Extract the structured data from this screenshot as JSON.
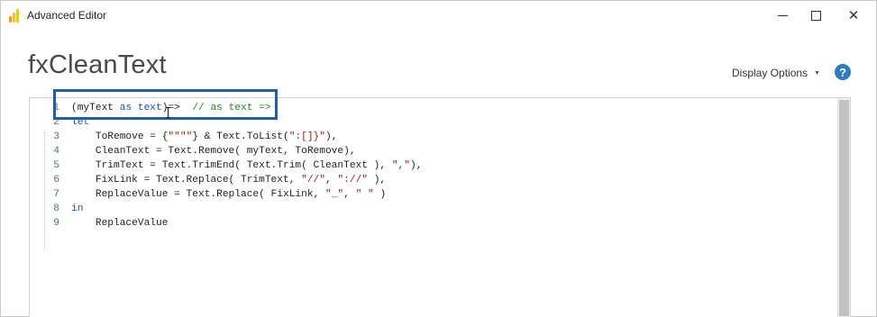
{
  "window": {
    "title": "Advanced Editor",
    "icon": "power-bi-icon",
    "minimize_icon": "minimize-icon",
    "maximize_icon": "maximize-icon",
    "close_label": "✕"
  },
  "header": {
    "query_name": "fxCleanText",
    "display_options_label": "Display Options",
    "display_options_caret": "▼",
    "help_label": "?"
  },
  "editor": {
    "lines": [
      {
        "number": "1",
        "tokens": [
          {
            "text": "(myText ",
            "kind": "plain"
          },
          {
            "text": "as",
            "kind": "keyword"
          },
          {
            "text": " ",
            "kind": "plain"
          },
          {
            "text": "text",
            "kind": "keyword"
          },
          {
            "text": ")=>  ",
            "kind": "plain"
          },
          {
            "text": "// as text =>",
            "kind": "comment"
          }
        ]
      },
      {
        "number": "2",
        "tokens": [
          {
            "text": "let",
            "kind": "keyword"
          }
        ]
      },
      {
        "number": "3",
        "tokens": [
          {
            "text": "    ToRemove = {",
            "kind": "plain"
          },
          {
            "text": "\"\"\"\"",
            "kind": "string"
          },
          {
            "text": "} & Text.ToList(",
            "kind": "plain"
          },
          {
            "text": "\":[]}\"",
            "kind": "string"
          },
          {
            "text": "),",
            "kind": "plain"
          }
        ]
      },
      {
        "number": "4",
        "tokens": [
          {
            "text": "    CleanText = Text.Remove( myText, ToRemove),",
            "kind": "plain"
          }
        ]
      },
      {
        "number": "5",
        "tokens": [
          {
            "text": "    TrimText = Text.TrimEnd( Text.Trim( CleanText ), ",
            "kind": "plain"
          },
          {
            "text": "\",\"",
            "kind": "string"
          },
          {
            "text": "),",
            "kind": "plain"
          }
        ]
      },
      {
        "number": "6",
        "tokens": [
          {
            "text": "    FixLink = Text.Replace( TrimText, ",
            "kind": "plain"
          },
          {
            "text": "\"//\"",
            "kind": "string"
          },
          {
            "text": ", ",
            "kind": "plain"
          },
          {
            "text": "\"://\"",
            "kind": "string"
          },
          {
            "text": " ),",
            "kind": "plain"
          }
        ]
      },
      {
        "number": "7",
        "tokens": [
          {
            "text": "    ReplaceValue = Text.Replace( FixLink, ",
            "kind": "plain"
          },
          {
            "text": "\"_\"",
            "kind": "string"
          },
          {
            "text": ", ",
            "kind": "plain"
          },
          {
            "text": "\" \"",
            "kind": "string"
          },
          {
            "text": " )",
            "kind": "plain"
          }
        ]
      },
      {
        "number": "8",
        "tokens": [
          {
            "text": "in",
            "kind": "keyword"
          }
        ]
      },
      {
        "number": "9",
        "tokens": [
          {
            "text": "    ReplaceValue",
            "kind": "plain"
          }
        ]
      }
    ]
  },
  "colors": {
    "keyword": "#1a4fc3",
    "string": "#a31515",
    "comment": "#1e8a1e",
    "highlight_border": "#1b5fad",
    "help_icon": "#2b7cc1",
    "powerbi_yellow": "#f2c811",
    "powerbi_dark": "#e8a700"
  }
}
